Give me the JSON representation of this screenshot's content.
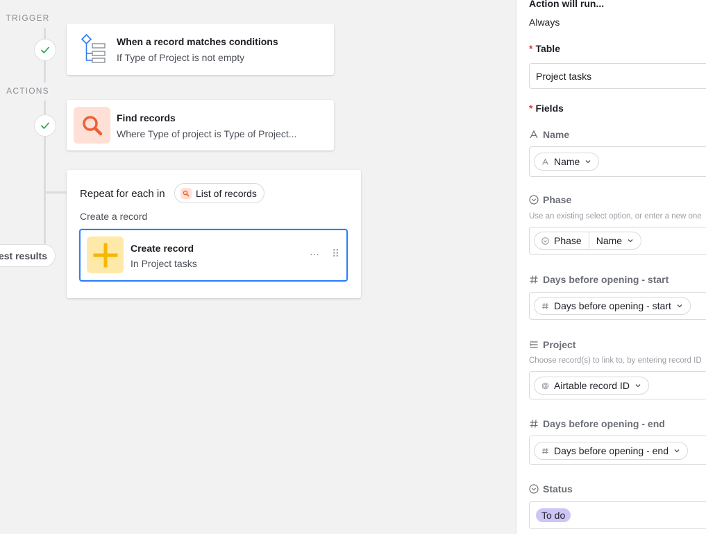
{
  "canvas": {
    "trigger_label": "TRIGGER",
    "actions_label": "ACTIONS",
    "trigger_card": {
      "title": "When a record matches conditions",
      "subtitle": "If Type of Project is not empty"
    },
    "find_card": {
      "title": "Find records",
      "subtitle": "Where Type of project is Type of Project..."
    },
    "repeat_card": {
      "title": "Repeat for each in",
      "list_pill": "List of records",
      "subheading": "Create a record",
      "inner": {
        "title": "Create record",
        "subtitle": "In Project tasks",
        "more": "···",
        "drag": "⠿"
      }
    },
    "test_results": "test results"
  },
  "panel": {
    "action_will_run_label": "Action will run...",
    "action_will_run_value": "Always",
    "table": {
      "required": "*",
      "label": "Table",
      "value": "Project tasks"
    },
    "fields": {
      "required": "*",
      "label": "Fields",
      "items": [
        {
          "label": "Name",
          "icon": "text-icon",
          "help": "",
          "tokens": [
            "Name"
          ]
        },
        {
          "label": "Phase",
          "icon": "select-icon",
          "help": "Use an existing select option, or enter a new one",
          "tokens": [
            "Phase",
            "Name"
          ]
        },
        {
          "label": "Days before opening - start",
          "icon": "number-icon",
          "help": "",
          "tokens": [
            "Days before opening - start"
          ]
        },
        {
          "label": "Project",
          "icon": "link-icon",
          "help": "Choose record(s) to link to, by entering record ID",
          "tokens": [
            "Airtable record ID"
          ]
        },
        {
          "label": "Days before opening - end",
          "icon": "number-icon",
          "help": "",
          "tokens": [
            "Days before opening - end"
          ]
        },
        {
          "label": "Status",
          "icon": "select-icon",
          "help": "",
          "badge": "To do"
        }
      ]
    }
  },
  "colors": {
    "accent_blue": "#2d7ff9",
    "check_green": "#20a34a",
    "find_icon_bg": "#ffe0d6",
    "find_icon": "#ef5f30",
    "create_icon_bg": "#ffe9a8",
    "create_icon": "#f5b800",
    "status_badge": "#cfc4f6"
  }
}
